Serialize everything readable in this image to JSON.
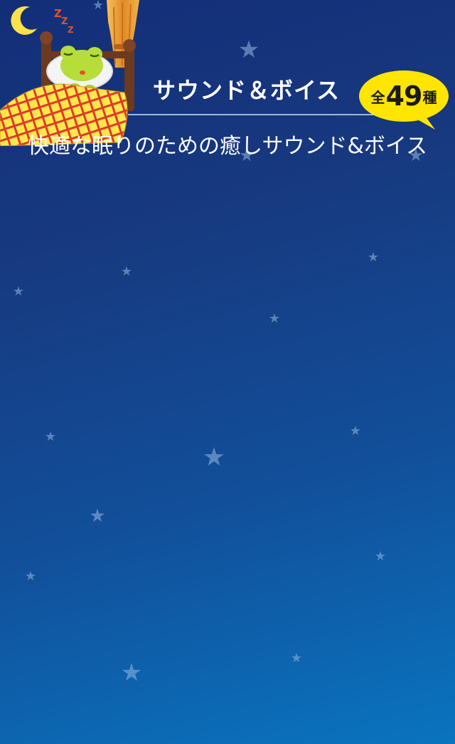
{
  "header": {
    "title": "サウンド＆ボイス",
    "subtitle": "快適な眠りのための癒しサウンド&ボイス"
  },
  "badge": {
    "prefix": "全",
    "number": "49",
    "suffix": "種"
  },
  "illustration": {
    "zzz": [
      "Z",
      "Z",
      "Z"
    ]
  },
  "colors": {
    "background_top": "#132e78",
    "background_bottom": "#0a74bf",
    "badge_fill": "#ffe500",
    "moon": "#ffe14a",
    "blanket": "#ffe84a",
    "blanket_grid": "#e03a2a",
    "frog": "#b6dd3a",
    "curtain": "#e8a13a",
    "bed_frame": "#6b3a1f",
    "star": "#8fb4e0"
  },
  "icons": [
    "moon-icon",
    "zzz-icon",
    "sleeping-frog-icon",
    "bed-icon",
    "curtain-icon",
    "star-icon"
  ]
}
